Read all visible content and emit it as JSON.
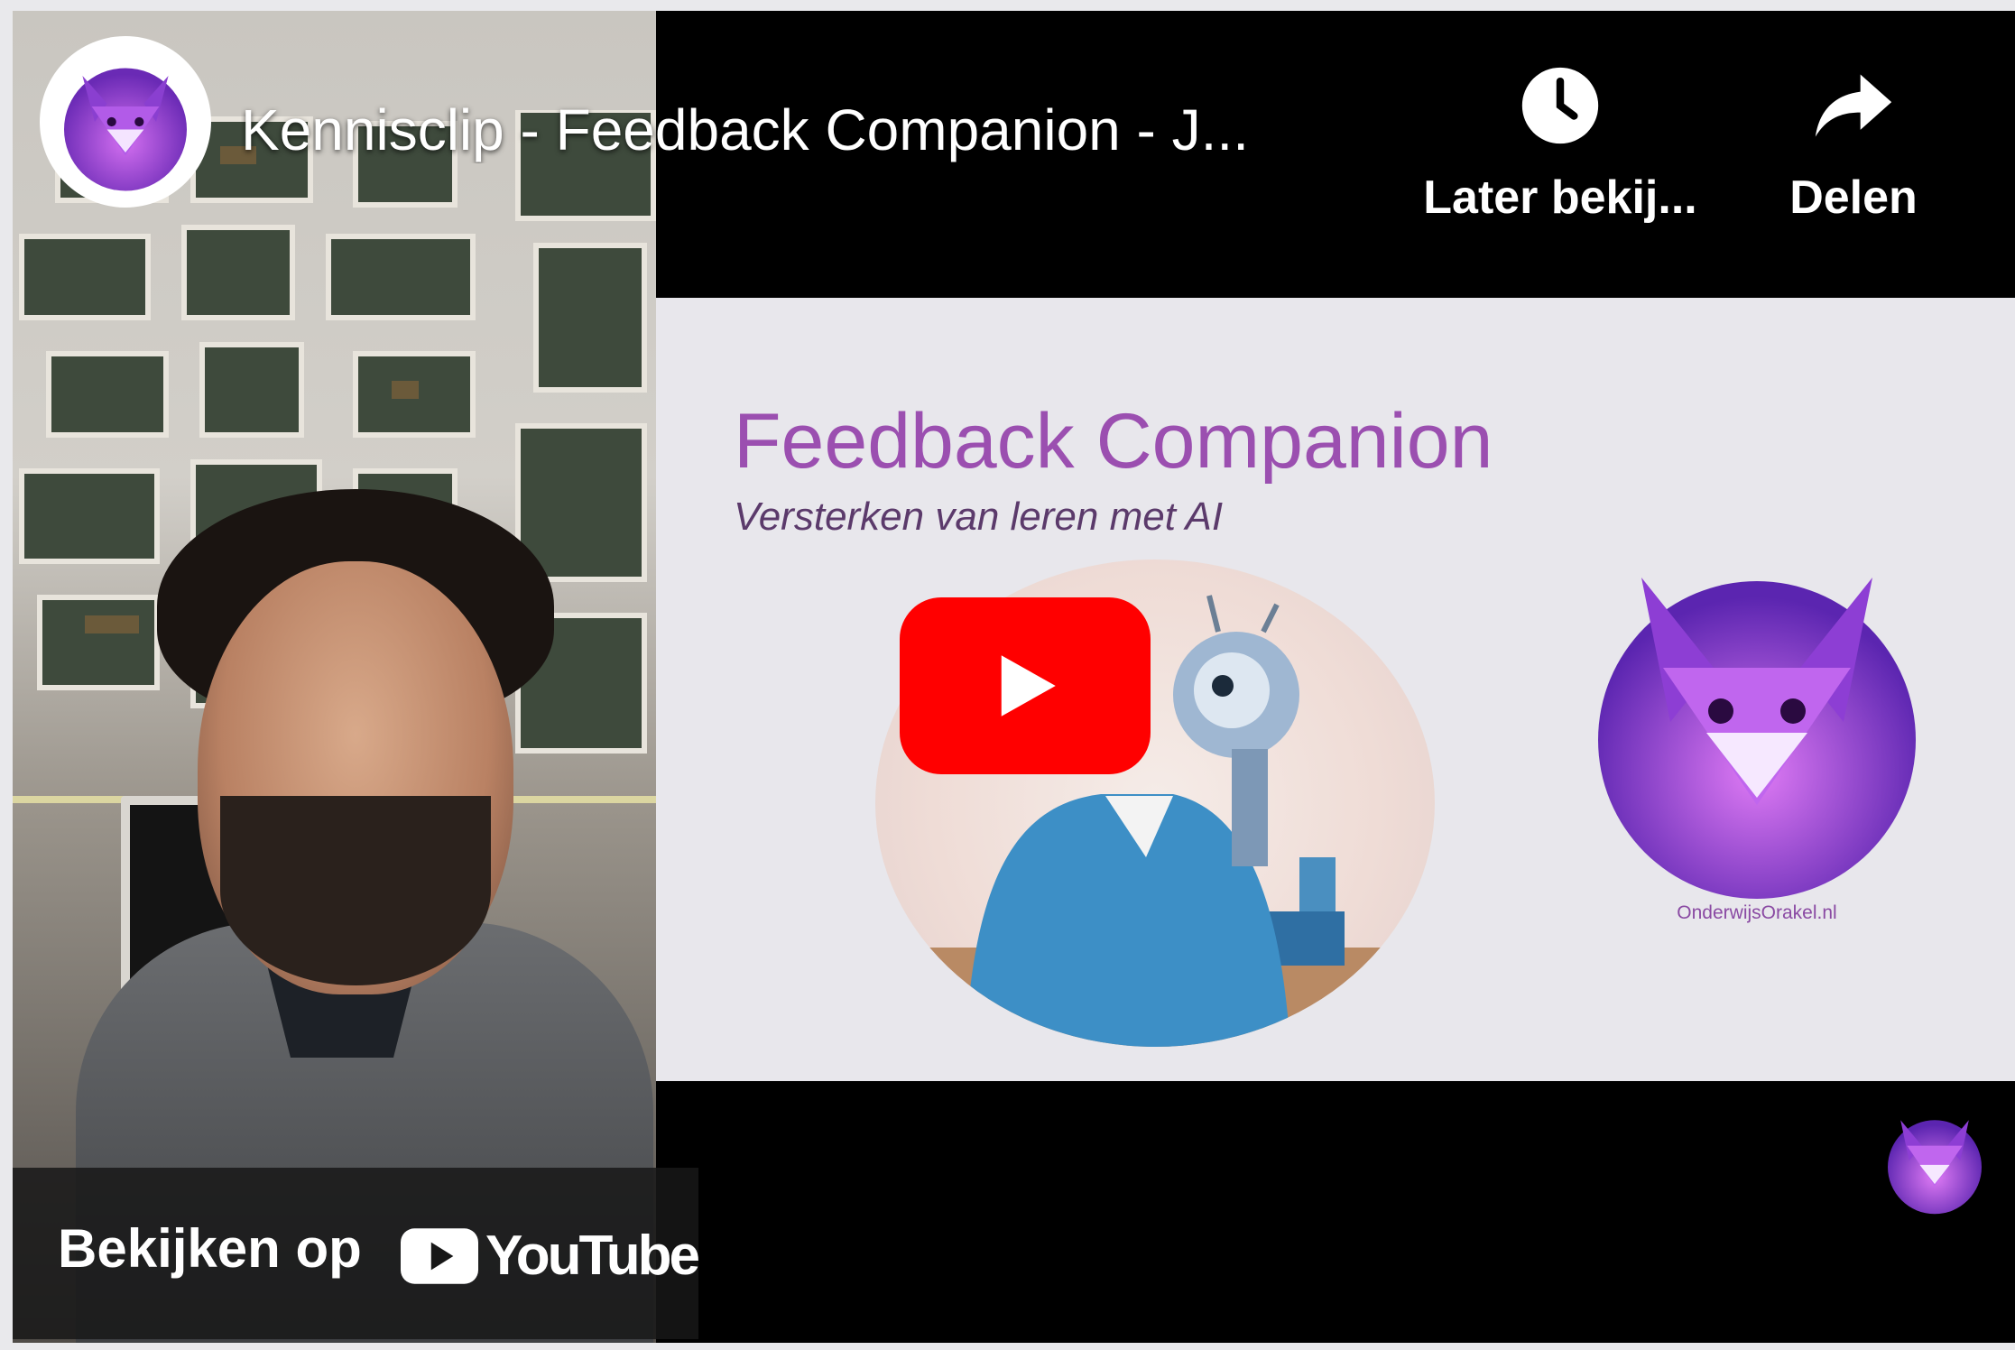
{
  "player": {
    "title": "Kennisclip - Feedback Companion - J...",
    "channel_icon": "fox-logo-icon"
  },
  "actions": {
    "watch_later_label": "Later bekij...",
    "watch_later_icon": "clock-icon",
    "share_label": "Delen",
    "share_icon": "share-arrow-icon"
  },
  "slide": {
    "title": "Feedback Companion",
    "subtitle": "Versterken van leren met AI",
    "logo_caption": "OnderwijsOrakel.nl"
  },
  "watch_on": {
    "text": "Bekijken op",
    "brand": "YouTube"
  },
  "colors": {
    "accent_purple": "#9b4fb0",
    "youtube_red": "#ff0000",
    "player_bg": "#000000"
  }
}
